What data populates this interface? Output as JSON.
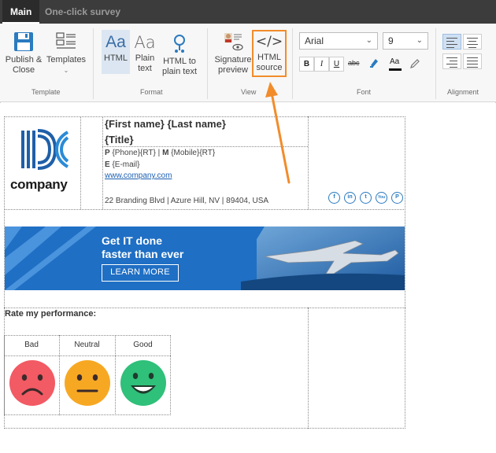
{
  "tabs": [
    {
      "label": "Main",
      "active": true
    },
    {
      "label": "One-click survey",
      "active": false
    }
  ],
  "ribbon": {
    "template_group": {
      "label": "Template",
      "publish": {
        "line1": "Publish &",
        "line2": "Close",
        "icon": "save-icon"
      },
      "templates": {
        "label": "Templates",
        "icon": "templates-icon"
      }
    },
    "format_group": {
      "label": "Format",
      "html": {
        "label": "HTML",
        "glyph": "Aa"
      },
      "plain": {
        "line1": "Plain",
        "line2": "text",
        "glyph": "Aa"
      },
      "html_to_plain": {
        "line1": "HTML to",
        "line2": "plain text",
        "icon": "convert-icon"
      }
    },
    "view_group": {
      "label": "View",
      "preview": {
        "line1": "Signature",
        "line2": "preview",
        "icon": "preview-icon"
      },
      "source": {
        "line1": "HTML",
        "line2": "source",
        "glyph": "</>"
      }
    },
    "font_group": {
      "label": "Font",
      "font_name": "Arial",
      "font_size": "9",
      "bold": "B",
      "italic": "I",
      "underline": "U",
      "strike": "abc",
      "font_color": "Aa"
    },
    "alignment_group": {
      "label": "Alignment"
    }
  },
  "signature": {
    "logo_text": "company",
    "name_line": "{First name} {Last name}",
    "title_line": "{Title}",
    "phone_prefix": "P",
    "phone_value": "{Phone}{RT}",
    "sep": "|",
    "mobile_prefix": "M",
    "mobile_value": "{Mobile}{RT}",
    "email_prefix": "E",
    "email_value": "{E-mail}",
    "website": "www.company.com",
    "address": "22 Branding Blvd | Azure Hill, NV | 89404, USA",
    "social": [
      {
        "name": "facebook",
        "glyph": "f"
      },
      {
        "name": "linkedin",
        "glyph": "in"
      },
      {
        "name": "twitter",
        "glyph": "t"
      },
      {
        "name": "youtube",
        "glyph": "You"
      },
      {
        "name": "pinterest",
        "glyph": "P"
      }
    ]
  },
  "banner": {
    "line1": "Get IT done",
    "line2": "faster than ever",
    "button": "LEARN MORE"
  },
  "survey": {
    "heading": "Rate my performance:",
    "options": [
      {
        "label": "Bad",
        "color": "#f25a64"
      },
      {
        "label": "Neutral",
        "color": "#f7a823"
      },
      {
        "label": "Good",
        "color": "#2fc07a"
      }
    ]
  },
  "colors": {
    "accent_arrow": "#f28c2b",
    "brand_blue": "#1f6fc4"
  }
}
